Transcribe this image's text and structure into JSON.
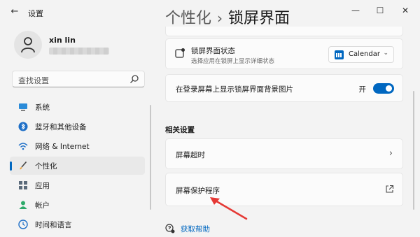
{
  "window": {
    "app_title": "设置",
    "back_icon": "arrow-left-icon",
    "controls": {
      "minimize": "—",
      "maximize": "☐",
      "close": "✕"
    }
  },
  "user": {
    "name": "xin lin",
    "email_obscured": true
  },
  "search": {
    "placeholder": "查找设置",
    "icon": "search-icon"
  },
  "sidebar": {
    "items": [
      {
        "label": "系统",
        "icon": "monitor-icon",
        "active": false
      },
      {
        "label": "蓝牙和其他设备",
        "icon": "bluetooth-icon",
        "active": false
      },
      {
        "label": "网络 & Internet",
        "icon": "wifi-icon",
        "active": false
      },
      {
        "label": "个性化",
        "icon": "brush-icon",
        "active": true
      },
      {
        "label": "应用",
        "icon": "apps-icon",
        "active": false
      },
      {
        "label": "帐户",
        "icon": "person-icon",
        "active": false
      },
      {
        "label": "时间和语言",
        "icon": "clock-globe-icon",
        "active": false
      }
    ]
  },
  "header": {
    "parent": "个性化",
    "separator": "›",
    "current": "锁屏界面"
  },
  "settings": {
    "lock_status": {
      "title": "锁屏界面状态",
      "subtitle": "选择应用在锁屏上显示详细状态",
      "dropdown_value": "Calendar"
    },
    "show_background": {
      "title": "在登录屏幕上显示锁屏界面背景图片",
      "toggle_label": "开",
      "toggle_on": true
    }
  },
  "related": {
    "section_title": "相关设置",
    "timeout_label": "屏幕超时",
    "screensaver_label": "屏幕保护程序"
  },
  "help": {
    "label": "获取帮助"
  },
  "colors": {
    "accent": "#0067c0",
    "annotation": "#e53935",
    "background": "#f3f3f3",
    "card": "#fbfbfb"
  }
}
